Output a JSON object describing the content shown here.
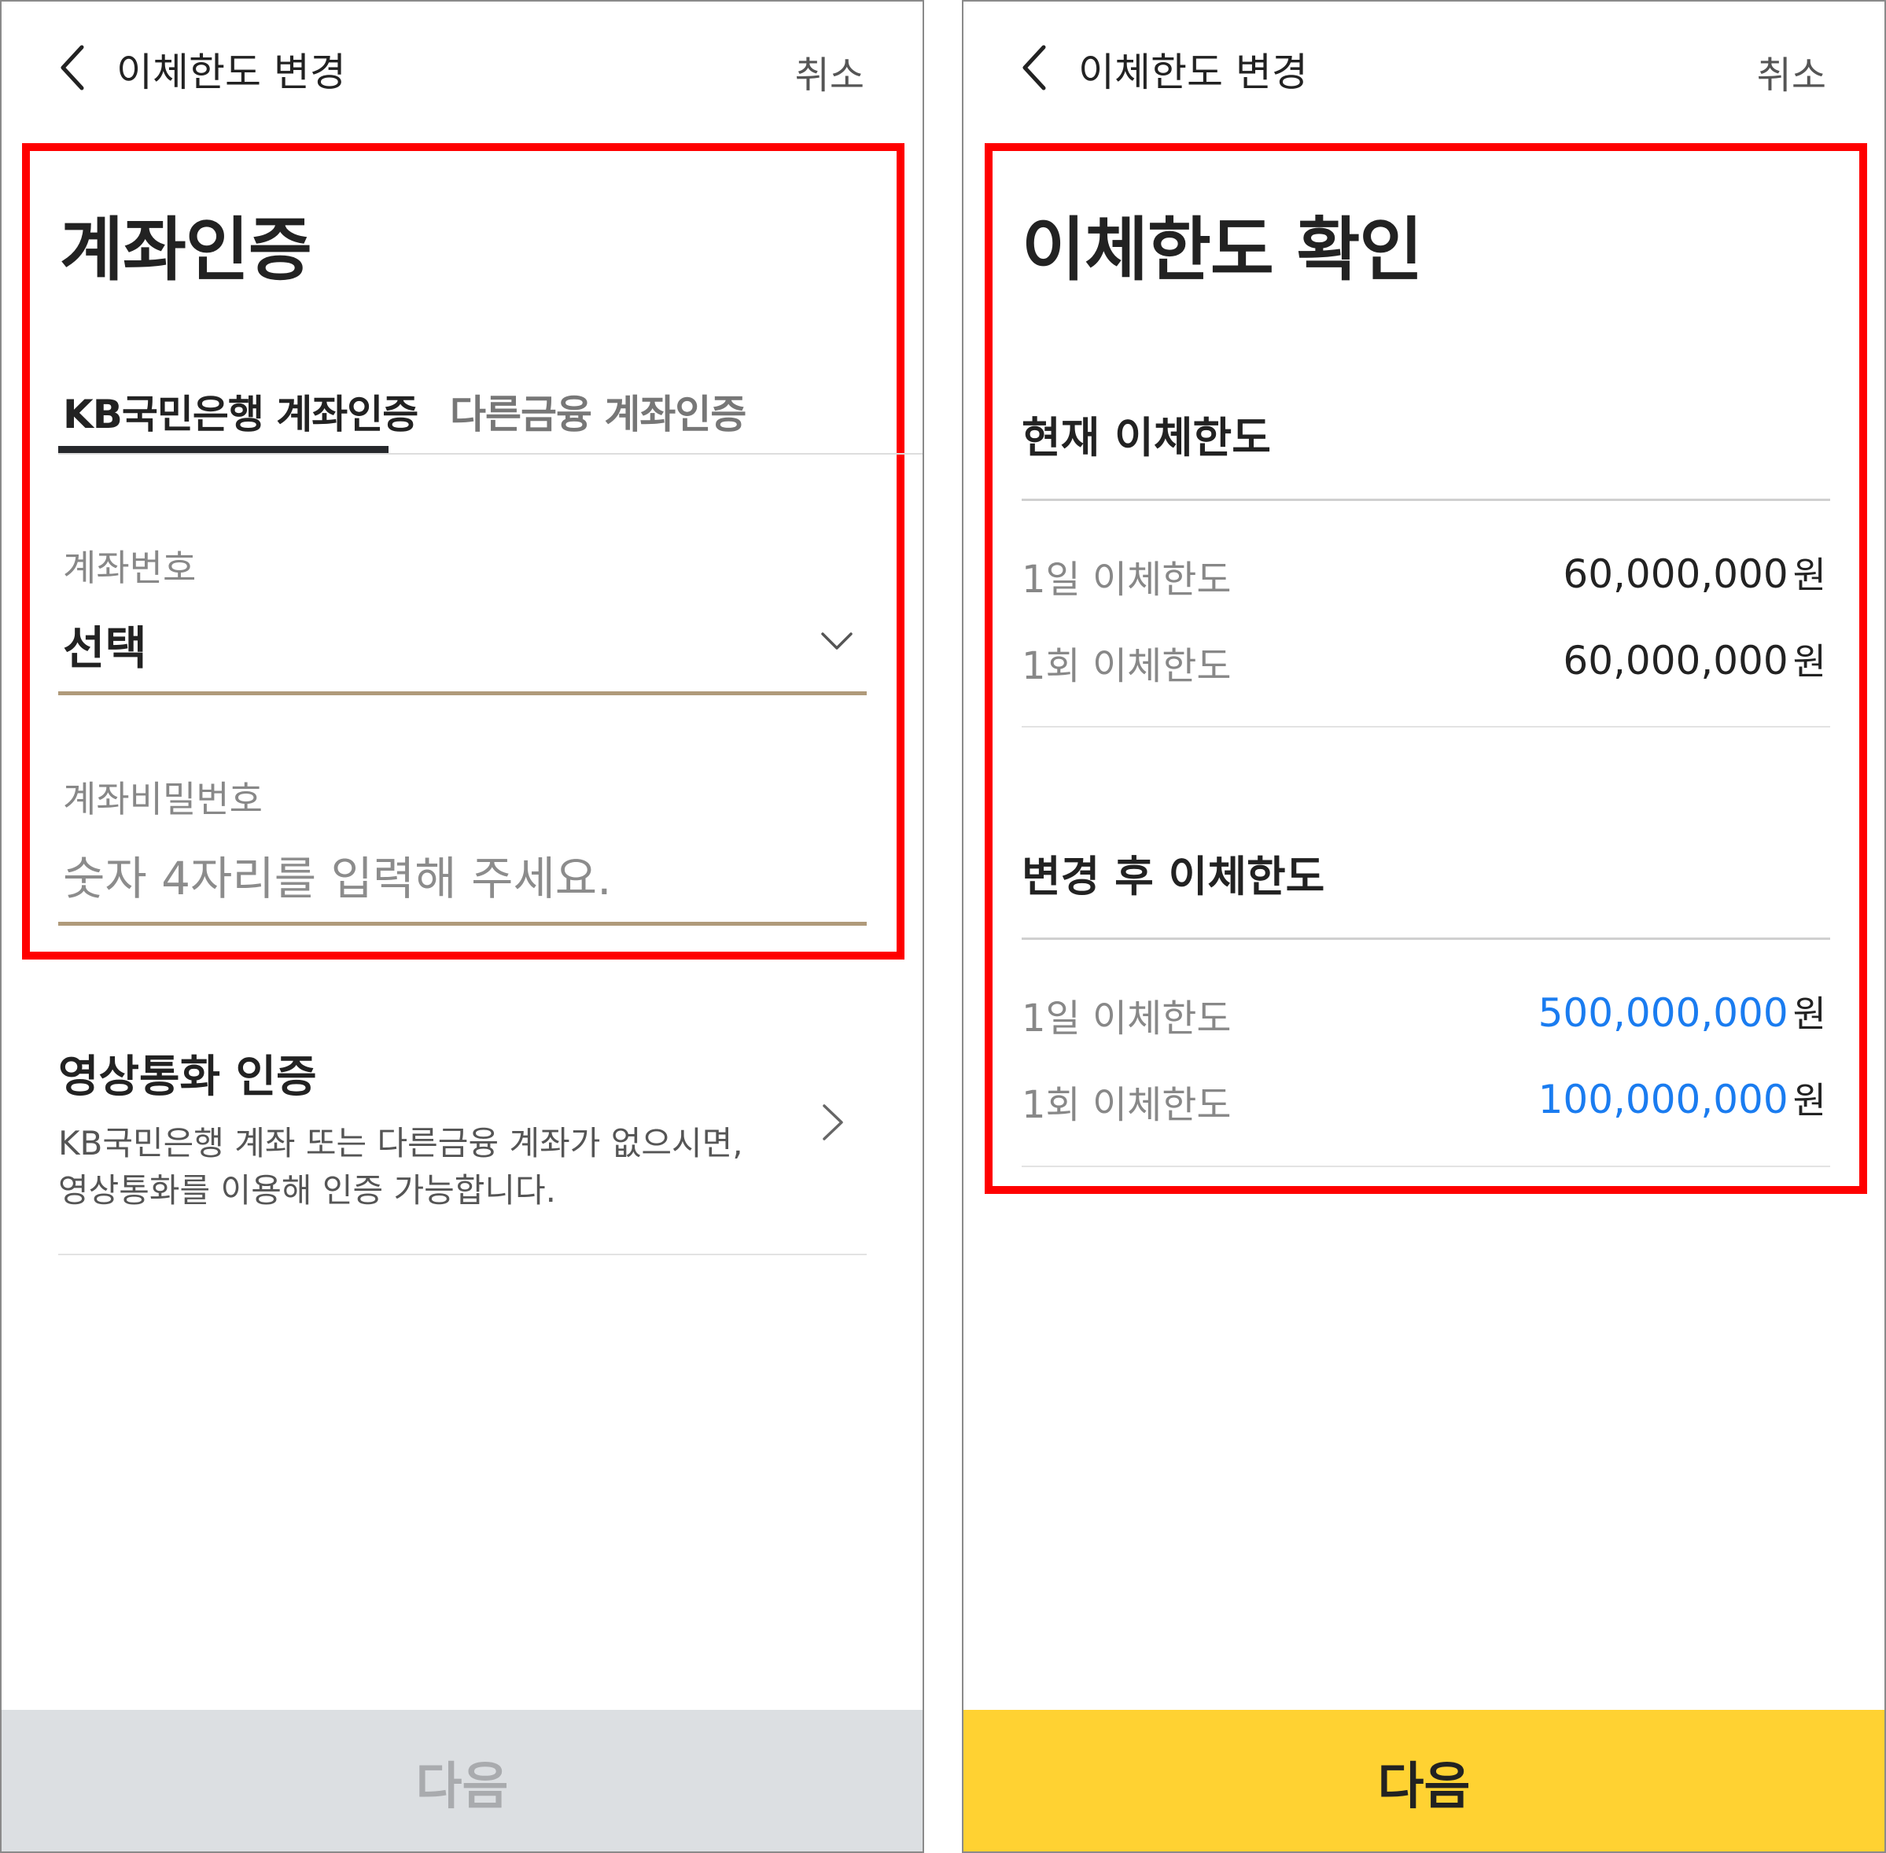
{
  "left_screen": {
    "header": {
      "title": "이체한도 변경",
      "cancel": "취소"
    },
    "page_title": "계좌인증",
    "tabs": [
      {
        "label": "KB국민은행 계좌인증",
        "active": true
      },
      {
        "label": "다른금융 계좌인증",
        "active": false
      }
    ],
    "account_number": {
      "label": "계좌번호",
      "value": "선택"
    },
    "account_password": {
      "label": "계좌비밀번호",
      "placeholder": "숫자 4자리를 입력해 주세요."
    },
    "video_call": {
      "title": "영상통화 인증",
      "description_line1": "KB국민은행 계좌 또는 다른금융 계좌가 없으시면,",
      "description_line2": "영상통화를 이용해 인증 가능합니다."
    },
    "next_button": {
      "label": "다음",
      "enabled": false
    }
  },
  "right_screen": {
    "header": {
      "title": "이체한도 변경",
      "cancel": "취소"
    },
    "page_title": "이체한도 확인",
    "current_limits": {
      "title": "현재 이체한도",
      "daily": {
        "label": "1일 이체한도",
        "amount": "60,000,000",
        "unit": "원"
      },
      "per_transfer": {
        "label": "1회 이체한도",
        "amount": "60,000,000",
        "unit": "원"
      }
    },
    "changed_limits": {
      "title": "변경 후 이체한도",
      "daily": {
        "label": "1일 이체한도",
        "amount": "500,000,000",
        "unit": "원"
      },
      "per_transfer": {
        "label": "1회 이체한도",
        "amount": "100,000,000",
        "unit": "원"
      }
    },
    "next_button": {
      "label": "다음",
      "enabled": true
    }
  },
  "colors": {
    "highlight_border": "#ff0000",
    "accent_yellow": "#ffd232",
    "amount_blue": "#1a7cf0",
    "field_underline": "#b09a7a",
    "disabled_button": "#dcdfe2"
  }
}
